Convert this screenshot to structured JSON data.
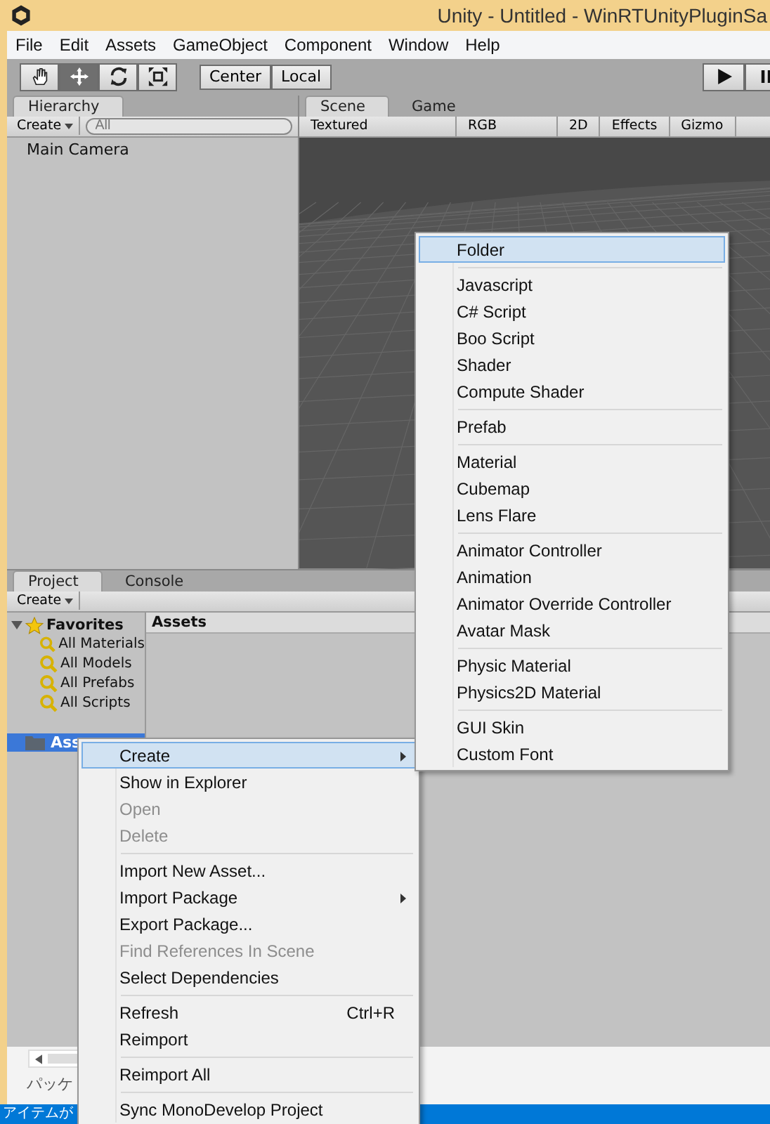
{
  "title_bar": {
    "title": "Unity - Untitled - WinRTUnityPluginSa"
  },
  "menu_bar": [
    "File",
    "Edit",
    "Assets",
    "GameObject",
    "Component",
    "Window",
    "Help"
  ],
  "toolbar": {
    "tools": [
      {
        "kind": "hand",
        "selected": false
      },
      {
        "kind": "move",
        "selected": true
      },
      {
        "kind": "rotate",
        "selected": false
      },
      {
        "kind": "scale",
        "selected": false
      }
    ],
    "pivot": [
      "Center",
      "Local"
    ]
  },
  "hierarchy": {
    "tab": "Hierarchy",
    "create": "Create",
    "search_placeholder": "All",
    "items": [
      "Main Camera"
    ]
  },
  "scene": {
    "tabs": [
      {
        "label": "Scene",
        "selected": true
      },
      {
        "label": "Game",
        "selected": false
      }
    ],
    "toolbar": [
      "Textured",
      "RGB",
      "2D",
      "Effects",
      "Gizmo"
    ]
  },
  "project": {
    "tabs": [
      {
        "label": "Project",
        "selected": true
      },
      {
        "label": "Console",
        "selected": false
      }
    ],
    "create": "Create",
    "favorites": {
      "label": "Favorites",
      "expanded": true,
      "items": [
        "All Materials",
        "All Models",
        "All Prefabs",
        "All Scripts"
      ]
    },
    "folders": [
      {
        "label": "Ass",
        "selected": true
      }
    ],
    "breadcrumb": "Assets"
  },
  "create_submenu": [
    {
      "kind": "item",
      "label": "Folder",
      "selected": true
    },
    {
      "kind": "separator"
    },
    {
      "kind": "item",
      "label": "Javascript",
      "selected": false
    },
    {
      "kind": "item",
      "label": "C# Script",
      "selected": false
    },
    {
      "kind": "item",
      "label": "Boo Script",
      "selected": false
    },
    {
      "kind": "item",
      "label": "Shader",
      "selected": false
    },
    {
      "kind": "item",
      "label": "Compute Shader",
      "selected": false
    },
    {
      "kind": "separator"
    },
    {
      "kind": "item",
      "label": "Prefab",
      "selected": false
    },
    {
      "kind": "separator"
    },
    {
      "kind": "item",
      "label": "Material",
      "selected": false
    },
    {
      "kind": "item",
      "label": "Cubemap",
      "selected": false
    },
    {
      "kind": "item",
      "label": "Lens Flare",
      "selected": false
    },
    {
      "kind": "separator"
    },
    {
      "kind": "item",
      "label": "Animator Controller",
      "selected": false
    },
    {
      "kind": "item",
      "label": "Animation",
      "selected": false
    },
    {
      "kind": "item",
      "label": "Animator Override Controller",
      "selected": false
    },
    {
      "kind": "item",
      "label": "Avatar Mask",
      "selected": false
    },
    {
      "kind": "separator"
    },
    {
      "kind": "item",
      "label": "Physic Material",
      "selected": false
    },
    {
      "kind": "item",
      "label": "Physics2D Material",
      "selected": false
    },
    {
      "kind": "separator"
    },
    {
      "kind": "item",
      "label": "GUI Skin",
      "selected": false
    },
    {
      "kind": "item",
      "label": "Custom Font",
      "selected": false
    }
  ],
  "context_menu": [
    {
      "kind": "item",
      "label": "Create",
      "selected": true,
      "disabled": false,
      "submenu": true
    },
    {
      "kind": "item",
      "label": "Show in Explorer",
      "selected": false,
      "disabled": false,
      "submenu": false
    },
    {
      "kind": "item",
      "label": "Open",
      "selected": false,
      "disabled": true,
      "submenu": false
    },
    {
      "kind": "item",
      "label": "Delete",
      "selected": false,
      "disabled": true,
      "submenu": false
    },
    {
      "kind": "separator"
    },
    {
      "kind": "item",
      "label": "Import New Asset...",
      "selected": false,
      "disabled": false,
      "submenu": false
    },
    {
      "kind": "item",
      "label": "Import Package",
      "selected": false,
      "disabled": false,
      "submenu": true
    },
    {
      "kind": "item",
      "label": "Export Package...",
      "selected": false,
      "disabled": false,
      "submenu": false
    },
    {
      "kind": "item",
      "label": "Find References In Scene",
      "selected": false,
      "disabled": true,
      "submenu": false
    },
    {
      "kind": "item",
      "label": "Select Dependencies",
      "selected": false,
      "disabled": false,
      "submenu": false
    },
    {
      "kind": "separator"
    },
    {
      "kind": "item",
      "label": "Refresh",
      "shortcut": "Ctrl+R",
      "selected": false,
      "disabled": false,
      "submenu": false
    },
    {
      "kind": "item",
      "label": "Reimport",
      "selected": false,
      "disabled": false,
      "submenu": false
    },
    {
      "kind": "separator"
    },
    {
      "kind": "item",
      "label": "Reimport All",
      "selected": false,
      "disabled": false,
      "submenu": false
    },
    {
      "kind": "separator"
    },
    {
      "kind": "item",
      "label": "Sync MonoDevelop Project",
      "selected": false,
      "disabled": false,
      "submenu": false
    }
  ],
  "host_window": {
    "label": "パッケ",
    "status_bar": "アイテムが"
  }
}
